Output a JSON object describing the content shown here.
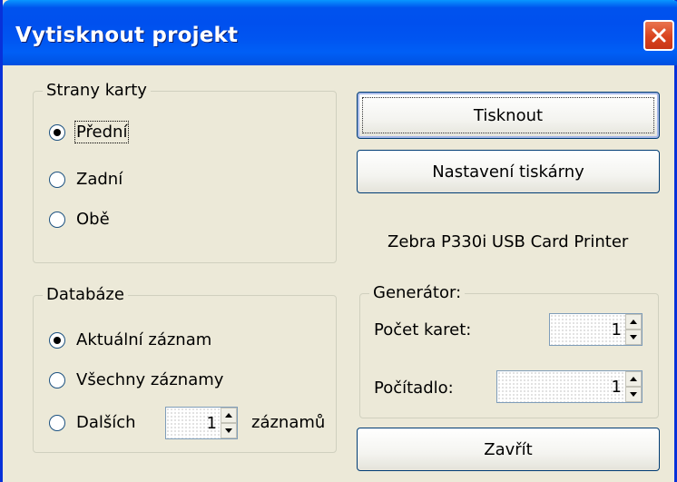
{
  "window": {
    "title": "Vytisknout projekt"
  },
  "card_sides": {
    "legend": "Strany karty",
    "options": [
      {
        "label": "Přední",
        "selected": true
      },
      {
        "label": "Zadní",
        "selected": false
      },
      {
        "label": "Obě",
        "selected": false
      }
    ]
  },
  "database": {
    "legend": "Databáze",
    "options": [
      {
        "label": "Aktuální záznam",
        "selected": true
      },
      {
        "label": "Všechny záznamy",
        "selected": false
      },
      {
        "label": "Dalších",
        "selected": false
      }
    ],
    "next_count": "1",
    "next_suffix": "záznamů"
  },
  "buttons": {
    "print": "Tisknout",
    "printer_settings": "Nastavení tiskárny",
    "close": "Zavřít"
  },
  "printer_name": "Zebra P330i USB Card Printer",
  "generator": {
    "legend": "Generátor:",
    "card_count_label": "Počet karet:",
    "card_count_value": "1",
    "counter_label": "Počítadlo:",
    "counter_value": "1"
  },
  "colors": {
    "titlebar": "#0054e3",
    "window_bg": "#ece9d8",
    "close": "#d9431f",
    "radio_selected": "#21a121"
  }
}
